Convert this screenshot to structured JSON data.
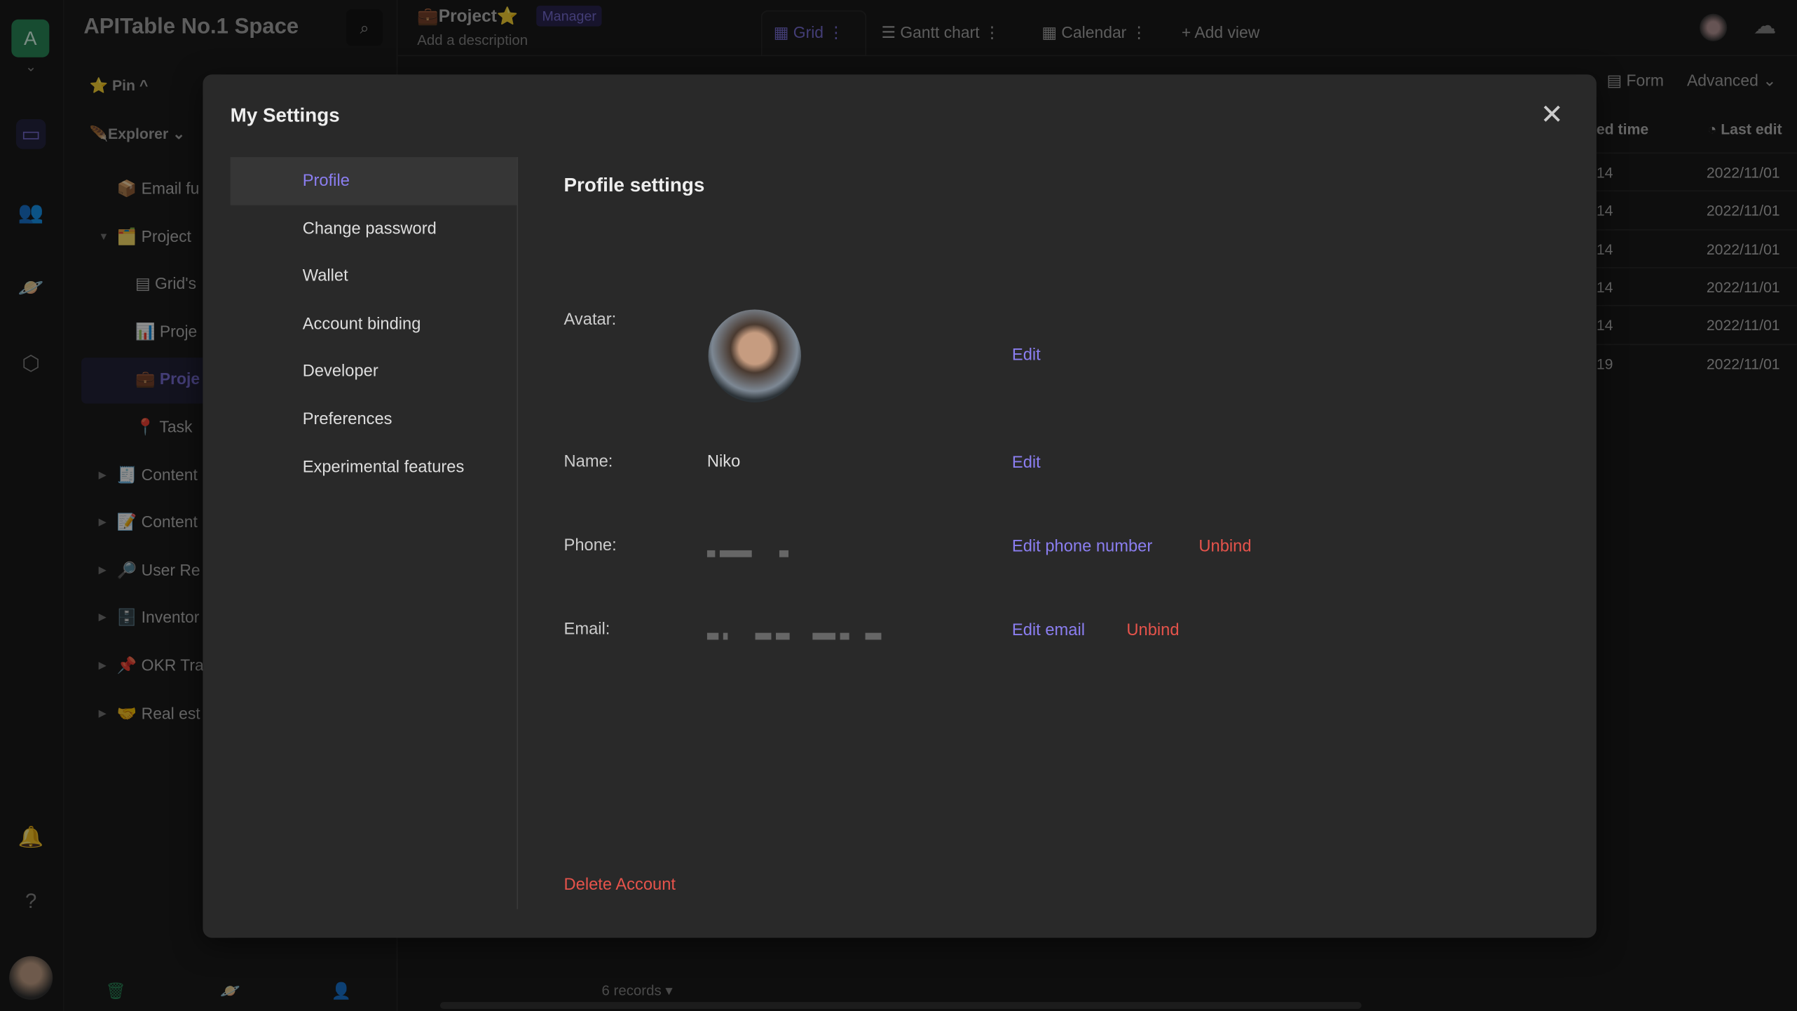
{
  "rail": {
    "workspace_initial": "A",
    "icons": [
      "workbench-icon",
      "contacts-icon",
      "templates-icon",
      "settings-icon",
      "bell-icon",
      "help-icon"
    ]
  },
  "sidebar": {
    "space_name": "APITable No.1 Space",
    "pin_label": "Pin",
    "explorer_label": "Explorer",
    "items": [
      {
        "emoji": "📦",
        "label": "Email fu"
      },
      {
        "emoji": "🗂️",
        "label": "Project"
      },
      {
        "emoji": "▤",
        "label": "Grid's"
      },
      {
        "emoji": "📊",
        "label": "Proje"
      },
      {
        "emoji": "💼",
        "label": "Proje"
      },
      {
        "emoji": "📍",
        "label": "Task"
      },
      {
        "emoji": "🧾",
        "label": "Content"
      },
      {
        "emoji": "📝",
        "label": "Content"
      },
      {
        "emoji": "🔎",
        "label": "User Re"
      },
      {
        "emoji": "🗄️",
        "label": "Inventor"
      },
      {
        "emoji": "📌",
        "label": "OKR Tra"
      },
      {
        "emoji": "🤝",
        "label": "Real est"
      }
    ]
  },
  "header": {
    "title": "Project",
    "role_badge": "Manager",
    "description": "Add a description",
    "views": [
      "Grid",
      "Gantt chart",
      "Calendar"
    ],
    "add_view": "Add view",
    "form": "Form",
    "advanced": "Advanced"
  },
  "grid": {
    "columns": [
      "ed time",
      "Last edit"
    ],
    "rows": [
      [
        "14",
        "2022/11/01"
      ],
      [
        "14",
        "2022/11/01"
      ],
      [
        "14",
        "2022/11/01"
      ],
      [
        "14",
        "2022/11/01"
      ],
      [
        "14",
        "2022/11/01"
      ],
      [
        "19",
        "2022/11/01"
      ]
    ],
    "footer": "6 records ▾"
  },
  "modal": {
    "title": "My Settings",
    "nav": [
      "Profile",
      "Change password",
      "Wallet",
      "Account binding",
      "Developer",
      "Preferences",
      "Experimental features"
    ],
    "section_title": "Profile settings",
    "avatar_label": "Avatar:",
    "name_label": "Name:",
    "name_value": "Niko",
    "phone_label": "Phone:",
    "email_label": "Email:",
    "edit": "Edit",
    "edit_phone": "Edit phone number",
    "edit_email": "Edit email",
    "unbind": "Unbind",
    "delete_account": "Delete Account"
  },
  "colors": {
    "accent": "#8b7ef0",
    "danger": "#e5534b",
    "workspace": "#2a8a5a"
  }
}
